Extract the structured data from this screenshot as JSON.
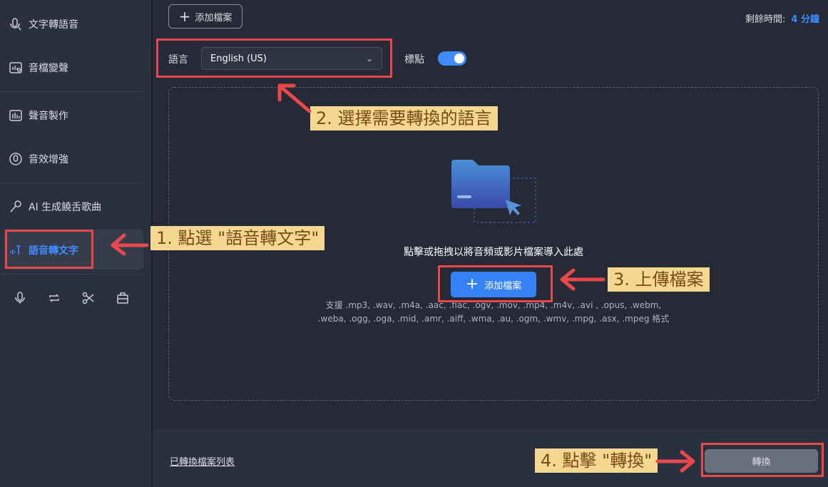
{
  "sidebar": {
    "items": [
      {
        "label": "文字轉語音",
        "icon": "text-to-speech-icon"
      },
      {
        "label": "音檔變聲",
        "icon": "voice-changer-icon"
      },
      {
        "label": "聲音製作",
        "icon": "voice-maker-icon"
      },
      {
        "label": "音效增強",
        "icon": "audio-enhance-icon"
      },
      {
        "label": "AI 生成饒舌歌曲",
        "icon": "ai-rap-icon"
      },
      {
        "label": "語音轉文字",
        "icon": "speech-to-text-icon",
        "active": true
      }
    ],
    "tools": [
      "microphone-icon",
      "repeat-icon",
      "scissors-icon",
      "toolbox-icon"
    ]
  },
  "header": {
    "add_file": "添加檔案",
    "remaining_label": "剩餘時間:",
    "remaining_value": "4 分鐘"
  },
  "language": {
    "label": "語言",
    "selected": "English (US)",
    "punctuation_label": "標點",
    "punctuation_on": true
  },
  "dropzone": {
    "prompt": "點擊或拖拽以將音頻或影片檔案導入此處",
    "add_file": "添加檔案",
    "support_line1": "支援 .mp3, .wav, .m4a, .aac, .flac, .ogv, .mov, .mp4, .m4v, .avi , .opus, .webm,",
    "support_line2": ".weba, .ogg, .oga, .mid, .amr, .aiff, .wma, .au, .ogm, .wmv, .mpg, .asx, .mpeg 格式"
  },
  "footer": {
    "converted_list": "已轉換檔案列表",
    "convert": "轉換"
  },
  "annotations": {
    "step1": "1. 點選 \"語音轉文字\"",
    "step2": "2. 選擇需要轉換的語言",
    "step3": "3. 上傳檔案",
    "step4": "4. 點擊 \"轉換\""
  },
  "colors": {
    "accent": "#3f8bff",
    "highlight": "#e8484c",
    "callout_bg": "#f4d88f"
  }
}
